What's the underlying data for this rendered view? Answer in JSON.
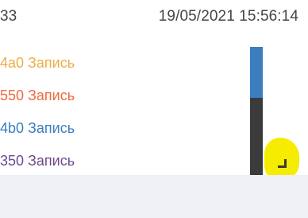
{
  "header": {
    "id_text": "33",
    "datetime": "19/05/2021 15:56:14"
  },
  "entries": [
    {
      "text": "4a0 Запись",
      "color": "#ecae48"
    },
    {
      "text": "550 Запись",
      "color": "#ef6a3f"
    },
    {
      "text": "4b0 Запись",
      "color": "#3c7dc2"
    },
    {
      "text": "350 Запись",
      "color": "#6d4a8e"
    }
  ],
  "colors": {
    "scroll_track": "#3b3b3b",
    "scroll_thumb": "#3b7dbf",
    "resize_highlight": "#f6ec00",
    "footer": "#eef0f4"
  },
  "icons": {
    "resize": "resize-corner-icon"
  }
}
